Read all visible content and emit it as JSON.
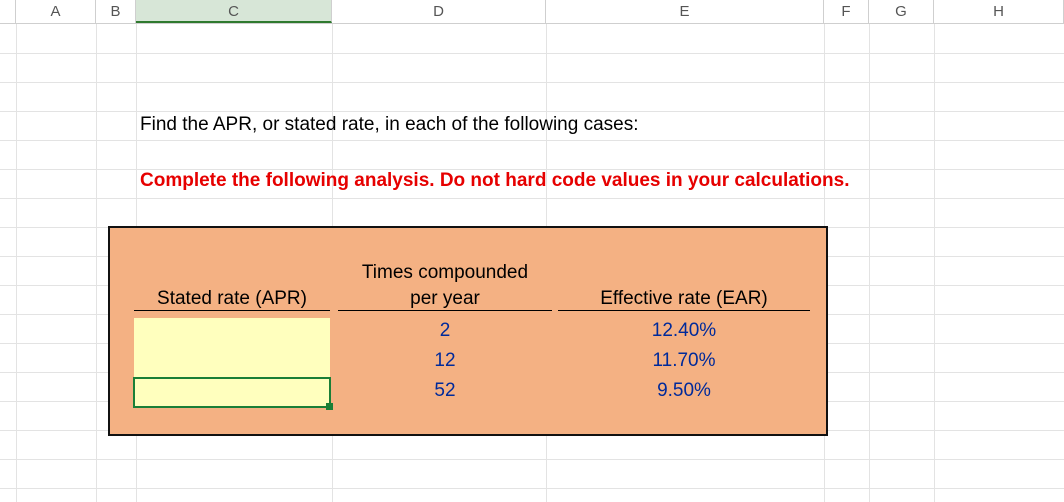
{
  "columns": {
    "A": "A",
    "B": "B",
    "C": "C",
    "D": "D",
    "E": "E",
    "F": "F",
    "G": "G",
    "H": "H"
  },
  "selected_column": "C",
  "body_text": {
    "line1": "Find the APR, or stated rate, in each of the following cases:",
    "line2": "Complete the following analysis. Do not hard code values in your calculations."
  },
  "table": {
    "headers": {
      "apr": "Stated rate (APR)",
      "times_line1": "Times compounded",
      "times_line2": "per year",
      "ear": "Effective rate (EAR)"
    },
    "rows": [
      {
        "apr": "",
        "times": "2",
        "ear": "12.40%"
      },
      {
        "apr": "",
        "times": "12",
        "ear": "11.70%"
      },
      {
        "apr": "",
        "times": "52",
        "ear": "9.50%"
      }
    ]
  },
  "chart_data": {
    "type": "table",
    "columns": [
      "Stated rate (APR)",
      "Times compounded per year",
      "Effective rate (EAR)"
    ],
    "rows": [
      [
        "",
        2,
        "12.40%"
      ],
      [
        "",
        12,
        "11.70%"
      ],
      [
        "",
        52,
        "9.50%"
      ]
    ],
    "title": "Find the APR, or stated rate, in each of the following cases"
  }
}
